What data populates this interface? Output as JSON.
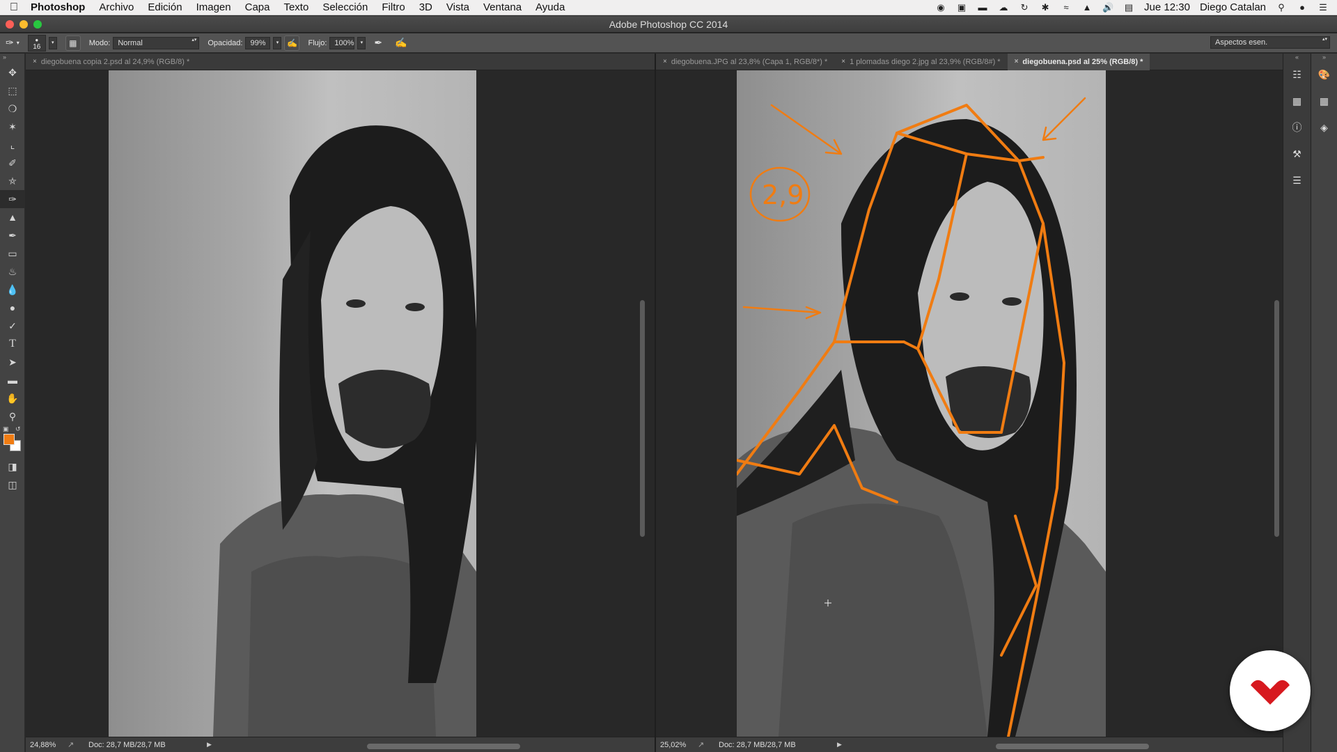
{
  "menubar": {
    "app_name": "Photoshop",
    "menus": [
      "Archivo",
      "Edición",
      "Imagen",
      "Capa",
      "Texto",
      "Selección",
      "Filtro",
      "3D",
      "Vista",
      "Ventana",
      "Ayuda"
    ],
    "clock": "Jue 12:30",
    "user": "Diego Catalan"
  },
  "window": {
    "title": "Adobe Photoshop CC 2014"
  },
  "options": {
    "brush_size": "16",
    "mode_label": "Modo:",
    "mode_value": "Normal",
    "opacity_label": "Opacidad:",
    "opacity_value": "99%",
    "flow_label": "Flujo:",
    "flow_value": "100%",
    "workspace": "Aspectos esen."
  },
  "colors": {
    "foreground": "#f07c12",
    "background": "#ffffff",
    "annotation": "#f07c12"
  },
  "left_doc": {
    "tab": "diegobuena copia 2.psd al 24,9% (RGB/8) *",
    "zoom": "24,88%",
    "doc_size": "Doc: 28,7 MB/28,7 MB"
  },
  "right_doc": {
    "tabs": [
      {
        "label": "diegobuena.JPG al 23,8% (Capa 1, RGB/8*) *",
        "active": false
      },
      {
        "label": "1 plomadas diego 2.jpg al 23,9% (RGB/8#) *",
        "active": false
      },
      {
        "label": "diegobuena.psd al 25% (RGB/8) *",
        "active": true
      }
    ],
    "zoom": "25,02%",
    "doc_size": "Doc: 28,7 MB/28,7 MB",
    "sketch_text": "2,9"
  }
}
